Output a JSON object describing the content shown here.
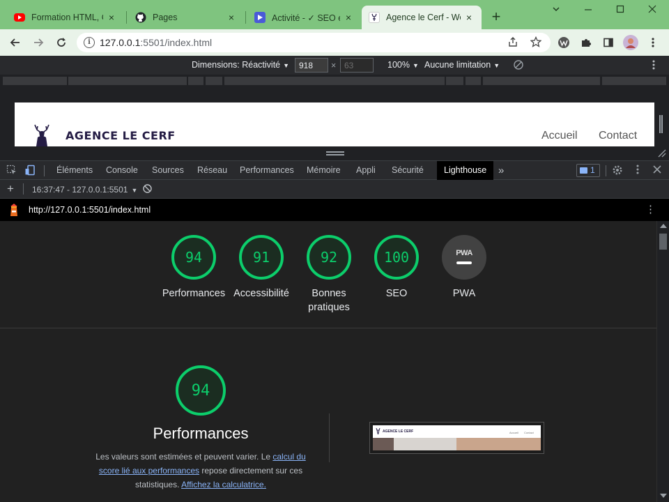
{
  "browser": {
    "tabs": [
      {
        "title": "Formation HTML, CSS",
        "icon": "youtube-icon"
      },
      {
        "title": "Pages",
        "icon": "github-icon"
      },
      {
        "title": "Activité - ✓ SEO é",
        "icon": "activity-icon"
      },
      {
        "title": "Agence le Cerf - We",
        "icon": "deer-favicon-icon",
        "active": true
      }
    ],
    "address": {
      "host": "127.0.0.1",
      "port_path": ":5501/index.html"
    }
  },
  "device_toolbar": {
    "dimensions_label": "Dimensions: Réactivité",
    "width": "918",
    "height_placeholder": "63",
    "times": "×",
    "zoom": "100%",
    "throttle": "Aucune limitation"
  },
  "site": {
    "brand": "AGENCE LE CERF",
    "nav": [
      "Accueil",
      "Contact"
    ]
  },
  "devtools": {
    "tabs": [
      "Éléments",
      "Console",
      "Sources",
      "Réseau",
      "Performances",
      "Mémoire",
      "Appli",
      "Sécurité",
      "Lighthouse"
    ],
    "active_tab": "Lighthouse",
    "more": "»",
    "issues_count": "1"
  },
  "lighthouse": {
    "report_select": "16:37:47 - 127.0.0.1:5501",
    "url": "http://127.0.0.1:5501/index.html",
    "categories": [
      {
        "score": "94",
        "label": "Performances"
      },
      {
        "score": "91",
        "label": "Accessibilité"
      },
      {
        "score": "92",
        "label": "Bonnes pratiques"
      },
      {
        "score": "100",
        "label": "SEO"
      }
    ],
    "pwa": {
      "badge": "PWA",
      "label": "PWA"
    },
    "performance": {
      "score": "94",
      "title": "Performances",
      "desc_1": "Les valeurs sont estimées et peuvent varier. Le ",
      "link_1": "calcul du score lié aux performances",
      "desc_2": " repose directement sur ces statistiques. ",
      "link_2": "Affichez la calculatrice."
    },
    "thumb": {
      "brand": "AGENCE LE CERF",
      "nav": [
        "Accueil",
        "Contact"
      ]
    },
    "score_color": "#0cce6b"
  }
}
